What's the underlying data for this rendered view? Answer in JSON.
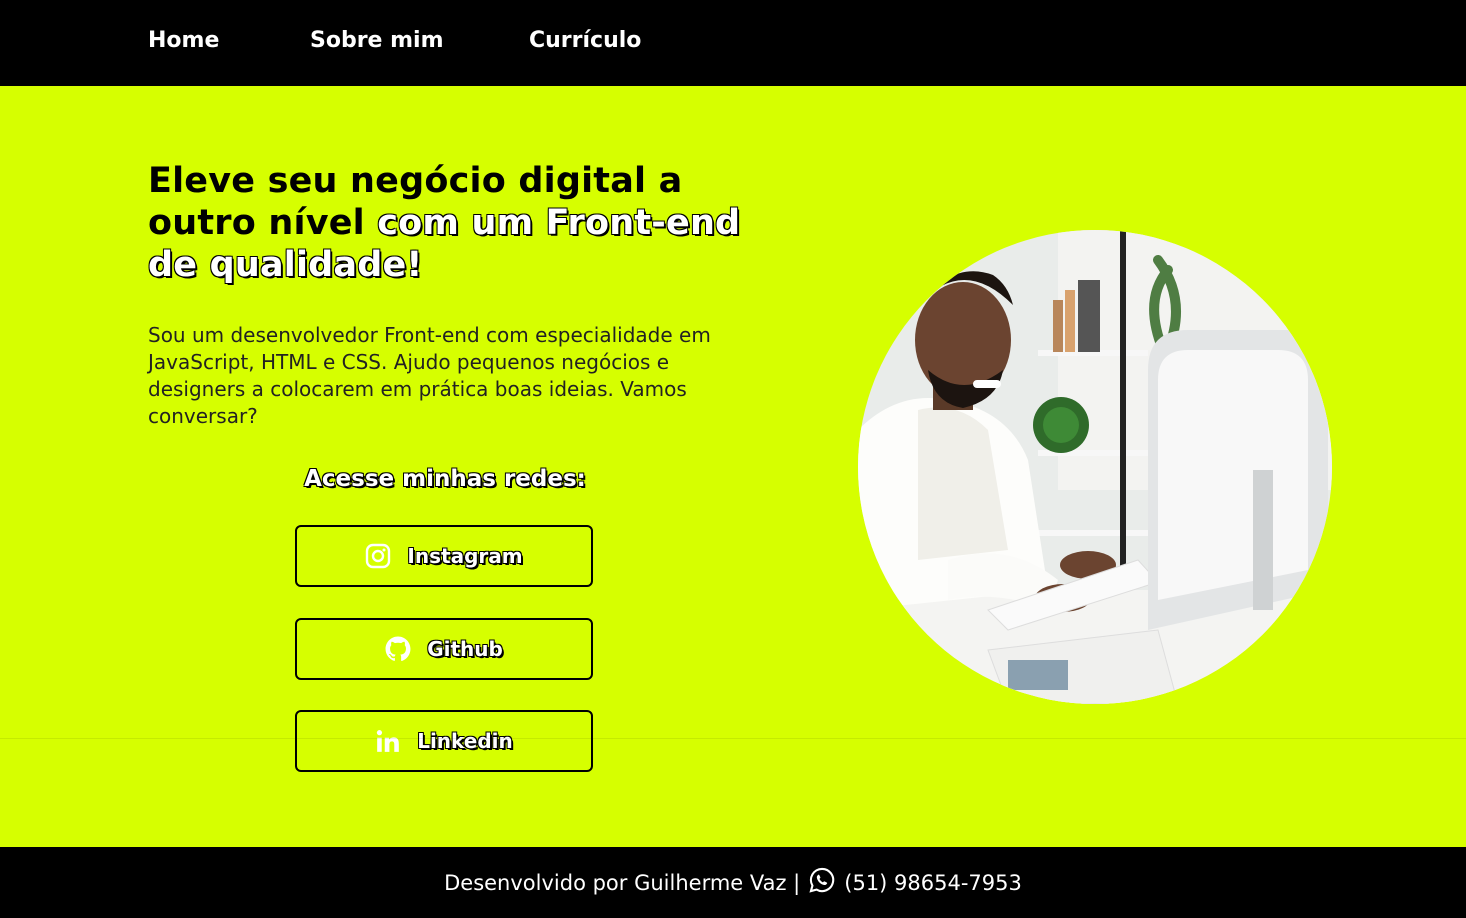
{
  "nav": {
    "home": "Home",
    "about": "Sobre mim",
    "resume": "Currículo"
  },
  "hero": {
    "title_part1": "Eleve seu negócio digital a outro nível ",
    "title_part2": "com um Front-end de qualidade!",
    "description": "Sou um desenvolvedor Front-end com especialidade em JavaScript, HTML e CSS. Ajudo pequenos negócios e designers a colocarem em prática boas ideias. Vamos conversar?",
    "photo_alt": "Homem sorrindo trabalhando em um computador"
  },
  "social": {
    "heading": "Acesse minhas redes:",
    "buttons": [
      {
        "label": "Instagram",
        "icon": "instagram-icon"
      },
      {
        "label": "Github",
        "icon": "github-icon"
      },
      {
        "label": "Linkedin",
        "icon": "linkedin-icon"
      }
    ]
  },
  "footer": {
    "text": "Desenvolvido por Guilherme Vaz |",
    "phone": "(51) 98654-7953",
    "icon": "whatsapp-icon"
  },
  "colors": {
    "accent": "#d6ff00",
    "dark": "#000000",
    "light": "#ffffff"
  }
}
